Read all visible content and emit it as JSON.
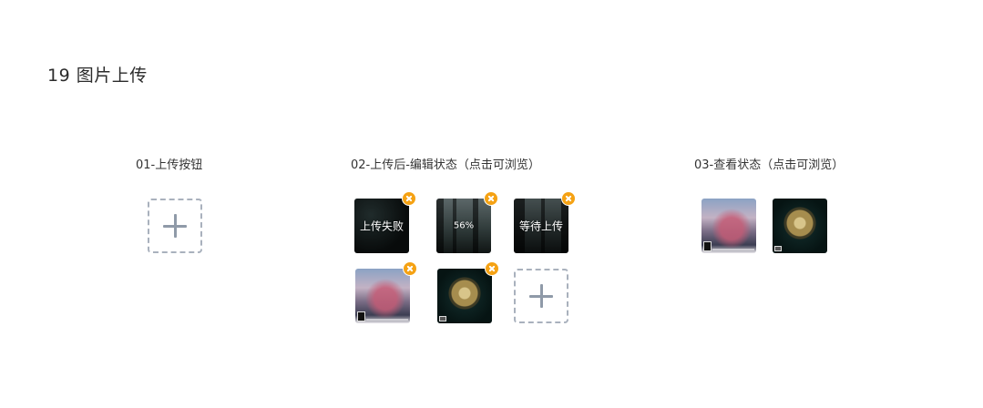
{
  "page": {
    "title": "19 图片上传"
  },
  "sections": {
    "s1": {
      "label": "01-上传按钮"
    },
    "s2": {
      "label": "02-上传后-编辑状态（点击可浏览）",
      "items": [
        {
          "status": "failed",
          "text": "上传失败",
          "image": "dark-photo",
          "removable": true
        },
        {
          "status": "uploading",
          "text": "56%",
          "progress": 0.56,
          "image": "forest-photo",
          "removable": true
        },
        {
          "status": "waiting",
          "text": "等待上传",
          "image": "forest-photo",
          "removable": true
        },
        {
          "status": "done",
          "text": "",
          "image": "sky-photo",
          "removable": true
        },
        {
          "status": "done",
          "text": "",
          "image": "globe-photo",
          "removable": true
        }
      ]
    },
    "s3": {
      "label": "03-查看状态（点击可浏览）",
      "items": [
        {
          "image": "sky-photo"
        },
        {
          "image": "globe-photo"
        }
      ]
    }
  },
  "icons": {
    "add": "plus-icon",
    "remove": "close-icon"
  },
  "colors": {
    "accent_badge": "#f5a214",
    "dashed_border": "#a9b1bd",
    "plus": "#8f9aa8"
  }
}
